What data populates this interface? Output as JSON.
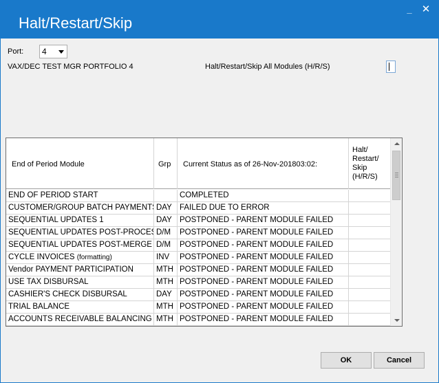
{
  "window": {
    "title": "Halt/Restart/Skip",
    "minimize_glyph": "_",
    "close_glyph": "✕"
  },
  "port": {
    "label": "Port:",
    "selected": "4"
  },
  "portfolio_name": "VAX/DEC TEST MGR PORTFOLIO 4",
  "all_modules": {
    "label": "Halt/Restart/Skip All Modules (H/R/S)",
    "value": ""
  },
  "grid": {
    "headers": {
      "module": "End of Period Module",
      "grp": "Grp",
      "status": "Current Status as of 26-Nov-201803:02:",
      "action": "Halt/\nRestart/\nSkip\n(H/R/S)"
    },
    "rows": [
      {
        "module": "END OF PERIOD START",
        "module_suffix": "",
        "grp": "",
        "status": "COMPLETED",
        "action": ""
      },
      {
        "module": "CUSTOMER/GROUP BATCH PAYMENTS",
        "module_suffix": "",
        "grp": "DAY",
        "status": "FAILED DUE TO ERROR",
        "action": ""
      },
      {
        "module": "SEQUENTIAL UPDATES  1",
        "module_suffix": "",
        "grp": "DAY",
        "status": "POSTPONED - PARENT MODULE FAILED",
        "action": ""
      },
      {
        "module": "SEQUENTIAL UPDATES POST-PROCES",
        "module_suffix": "",
        "grp": "D/M",
        "status": "POSTPONED - PARENT MODULE FAILED",
        "action": ""
      },
      {
        "module": "SEQUENTIAL UPDATES POST-MERGE",
        "module_suffix": "",
        "grp": "D/M",
        "status": "POSTPONED - PARENT MODULE FAILED",
        "action": ""
      },
      {
        "module": "CYCLE INVOICES ",
        "module_suffix": "(formatting)",
        "grp": "INV",
        "status": "POSTPONED - PARENT MODULE FAILED",
        "action": ""
      },
      {
        "module": "Vendor PAYMENT PARTICIPATION",
        "module_suffix": "",
        "grp": "MTH",
        "status": "POSTPONED - PARENT MODULE FAILED",
        "action": ""
      },
      {
        "module": "USE TAX DISBURSAL",
        "module_suffix": "",
        "grp": "MTH",
        "status": "POSTPONED - PARENT MODULE FAILED",
        "action": ""
      },
      {
        "module": "CASHIER'S CHECK DISBURSAL",
        "module_suffix": "",
        "grp": "DAY",
        "status": "POSTPONED - PARENT MODULE FAILED",
        "action": ""
      },
      {
        "module": "TRIAL BALANCE",
        "module_suffix": "",
        "grp": "MTH",
        "status": "POSTPONED - PARENT MODULE FAILED",
        "action": ""
      },
      {
        "module": "ACCOUNTS RECEIVABLE BALANCING",
        "module_suffix": "",
        "grp": "MTH",
        "status": "POSTPONED - PARENT MODULE FAILED",
        "action": ""
      }
    ]
  },
  "buttons": {
    "ok": "OK",
    "cancel": "Cancel"
  },
  "colors": {
    "titlebar": "#1979ca",
    "window_bg": "#f0f0f0"
  }
}
